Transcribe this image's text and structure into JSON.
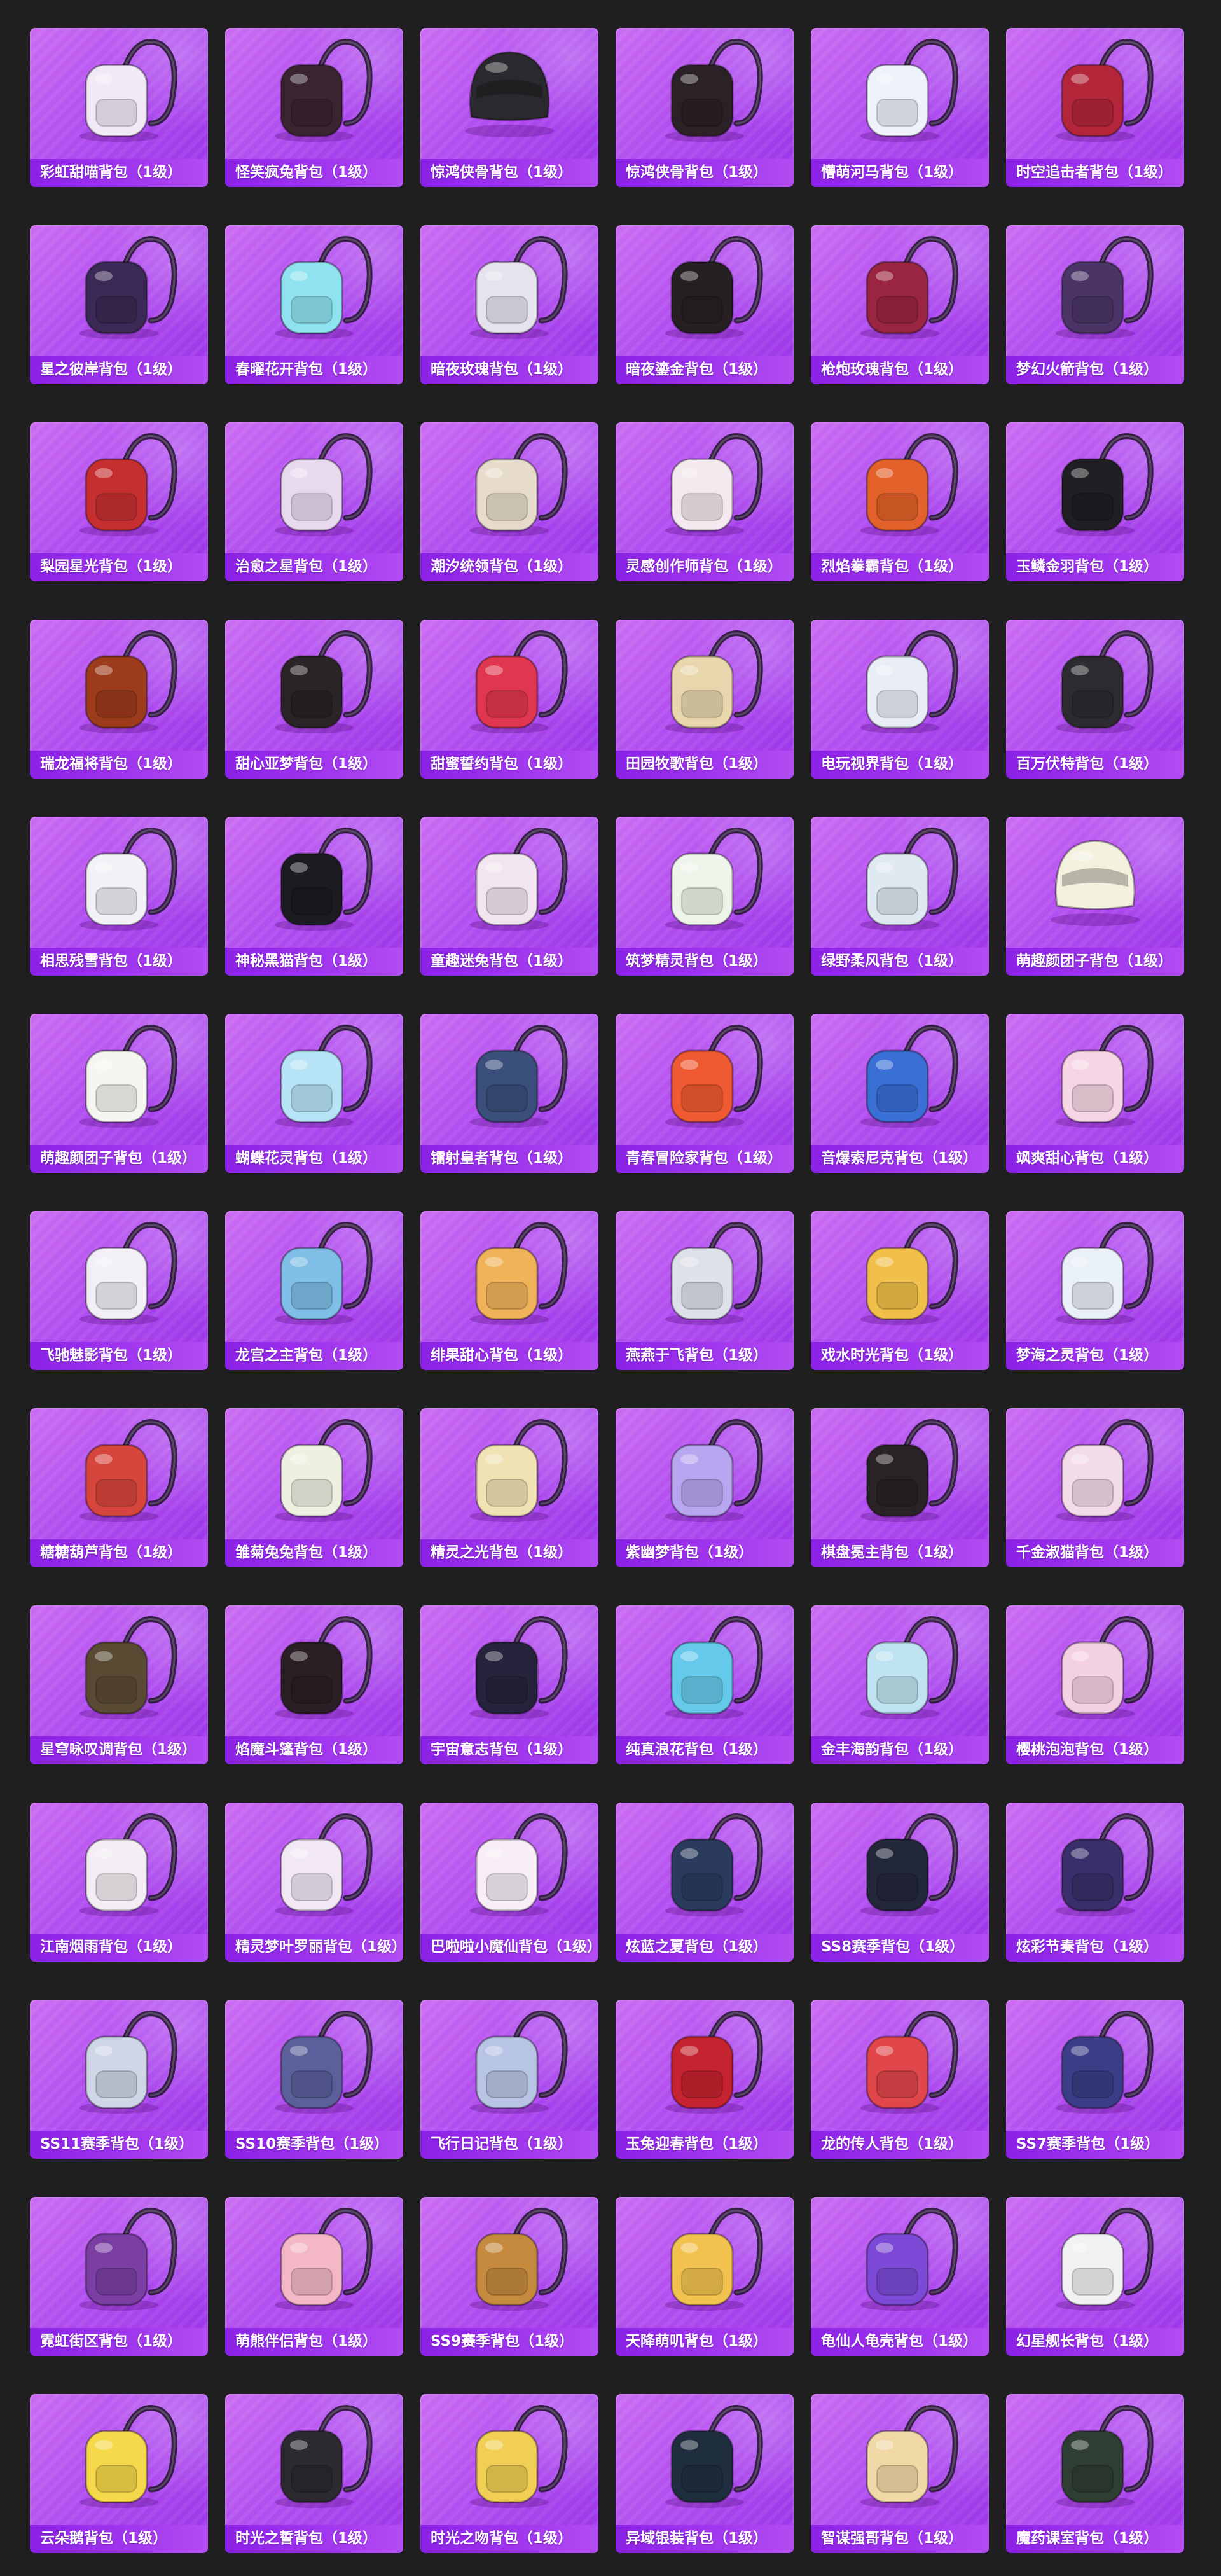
{
  "gallery": {
    "items": [
      {
        "label": "彩虹甜喵背包（1级）",
        "icon": "backpack-icon",
        "color": "#f2e9f6"
      },
      {
        "label": "怪笑疯兔背包（1级）",
        "icon": "backpack-icon",
        "color": "#3a2430"
      },
      {
        "label": "惊鸿侠骨背包（1级）",
        "icon": "helmet-icon",
        "color": "#2a2a2e"
      },
      {
        "label": "惊鸿侠骨背包（1级）",
        "icon": "backpack-icon",
        "color": "#2b2227"
      },
      {
        "label": "懵萌河马背包（1级）",
        "icon": "backpack-icon",
        "color": "#eef2fb"
      },
      {
        "label": "时空追击者背包（1级）",
        "icon": "backpack-icon",
        "color": "#b3263a"
      },
      {
        "label": "星之彼岸背包（1级）",
        "icon": "backpack-icon",
        "color": "#3b2a55"
      },
      {
        "label": "春曜花开背包（1级）",
        "icon": "backpack-icon",
        "color": "#8fe3f0"
      },
      {
        "label": "暗夜玫瑰背包（1级）",
        "icon": "backpack-icon",
        "color": "#e7e3ee"
      },
      {
        "label": "暗夜鎏金背包（1级）",
        "icon": "backpack-icon",
        "color": "#262022"
      },
      {
        "label": "枪炮玫瑰背包（1级）",
        "icon": "backpack-icon",
        "color": "#9a2540"
      },
      {
        "label": "梦幻火箭背包（1级）",
        "icon": "backpack-icon",
        "color": "#4a3566"
      },
      {
        "label": "梨园星光背包（1级）",
        "icon": "backpack-icon",
        "color": "#c62f2f"
      },
      {
        "label": "治愈之星背包（1级）",
        "icon": "backpack-icon",
        "color": "#e9d9ef"
      },
      {
        "label": "潮汐统领背包（1级）",
        "icon": "backpack-icon",
        "color": "#e7dccb"
      },
      {
        "label": "灵感创作师背包（1级）",
        "icon": "backpack-icon",
        "color": "#f3e9ef"
      },
      {
        "label": "烈焰拳霸背包（1级）",
        "icon": "backpack-icon",
        "color": "#e3612a"
      },
      {
        "label": "玉鳞金羽背包（1级）",
        "icon": "backpack-icon",
        "color": "#1f1f24"
      },
      {
        "label": "瑞龙福将背包（1级）",
        "icon": "backpack-icon",
        "color": "#9d3b1d"
      },
      {
        "label": "甜心亚梦背包（1级）",
        "icon": "backpack-icon",
        "color": "#2a2328"
      },
      {
        "label": "甜蜜誓约背包（1级）",
        "icon": "backpack-icon",
        "color": "#e0364f"
      },
      {
        "label": "田园牧歌背包（1级）",
        "icon": "backpack-icon",
        "color": "#e8d6ac"
      },
      {
        "label": "电玩视界背包（1级）",
        "icon": "backpack-icon",
        "color": "#e9eef6"
      },
      {
        "label": "百万伏特背包（1级）",
        "icon": "backpack-icon",
        "color": "#2d2b2f"
      },
      {
        "label": "相思残雪背包（1级）",
        "icon": "backpack-icon",
        "color": "#f2f2f6"
      },
      {
        "label": "神秘黑猫背包（1级）",
        "icon": "backpack-icon",
        "color": "#1d1b22"
      },
      {
        "label": "童趣迷兔背包（1级）",
        "icon": "backpack-icon",
        "color": "#f1e6ef"
      },
      {
        "label": "筑梦精灵背包（1级）",
        "icon": "backpack-icon",
        "color": "#eef4e9"
      },
      {
        "label": "绿野柔风背包（1级）",
        "icon": "backpack-icon",
        "color": "#dfe9f2"
      },
      {
        "label": "萌趣颜团子背包（1级）",
        "icon": "helmet-icon",
        "color": "#f3f2df"
      },
      {
        "label": "萌趣颜团子背包（1级）",
        "icon": "backpack-icon",
        "color": "#f6f6f0"
      },
      {
        "label": "蝴蝶花灵背包（1级）",
        "icon": "backpack-icon",
        "color": "#b6e3f6"
      },
      {
        "label": "镭射皇者背包（1级）",
        "icon": "backpack-icon",
        "color": "#3b4f7c"
      },
      {
        "label": "青春冒险家背包（1级）",
        "icon": "backpack-icon",
        "color": "#ef5a32"
      },
      {
        "label": "音爆索尼克背包（1级）",
        "icon": "backpack-icon",
        "color": "#3a6fd6"
      },
      {
        "label": "飒爽甜心背包（1级）",
        "icon": "backpack-icon",
        "color": "#f6d6e4"
      },
      {
        "label": "飞驰魅影背包（1级）",
        "icon": "backpack-icon",
        "color": "#f2f0f6"
      },
      {
        "label": "龙宫之主背包（1级）",
        "icon": "backpack-icon",
        "color": "#7fbfe7"
      },
      {
        "label": "绯果甜心背包（1级）",
        "icon": "backpack-icon",
        "color": "#f0b35a"
      },
      {
        "label": "燕燕于飞背包（1级）",
        "icon": "backpack-icon",
        "color": "#dfe1ea"
      },
      {
        "label": "戏水时光背包（1级）",
        "icon": "backpack-icon",
        "color": "#f0c04a"
      },
      {
        "label": "梦海之灵背包（1级）",
        "icon": "backpack-icon",
        "color": "#eaf0f8"
      },
      {
        "label": "糖糖葫芦背包（1级）",
        "icon": "backpack-icon",
        "color": "#d7463c"
      },
      {
        "label": "雏菊兔兔背包（1级）",
        "icon": "backpack-icon",
        "color": "#eef0e2"
      },
      {
        "label": "精灵之光背包（1级）",
        "icon": "backpack-icon",
        "color": "#f0e2b3"
      },
      {
        "label": "紫幽梦背包（1级）",
        "icon": "backpack-icon",
        "color": "#b7a6f0"
      },
      {
        "label": "棋盘冕主背包（1级）",
        "icon": "backpack-icon",
        "color": "#2a2326"
      },
      {
        "label": "千金淑猫背包（1级）",
        "icon": "backpack-icon",
        "color": "#f3dbe8"
      },
      {
        "label": "星穹咏叹调背包（1级）",
        "icon": "backpack-icon",
        "color": "#5a4a34"
      },
      {
        "label": "焰魔斗篷背包（1级）",
        "icon": "backpack-icon",
        "color": "#2a1f24"
      },
      {
        "label": "宇宙意志背包（1级）",
        "icon": "backpack-icon",
        "color": "#25243c"
      },
      {
        "label": "纯真浪花背包（1级）",
        "icon": "backpack-icon",
        "color": "#65c9ea"
      },
      {
        "label": "金丰海韵背包（1级）",
        "icon": "backpack-icon",
        "color": "#bfe3f0"
      },
      {
        "label": "樱桃泡泡背包（1级）",
        "icon": "backpack-icon",
        "color": "#f4d1e2"
      },
      {
        "label": "江南烟雨背包（1级）",
        "icon": "backpack-icon",
        "color": "#f3eef3"
      },
      {
        "label": "精灵梦叶罗丽背包（1级）",
        "icon": "backpack-icon",
        "color": "#f1e8f4"
      },
      {
        "label": "巴啦啦小魔仙背包（1级）",
        "icon": "backpack-icon",
        "color": "#f7eef6"
      },
      {
        "label": "炫蓝之夏背包（1级）",
        "icon": "backpack-icon",
        "color": "#2b3b5e"
      },
      {
        "label": "SS8赛季背包（1级）",
        "icon": "backpack-icon",
        "color": "#23273a"
      },
      {
        "label": "炫彩节奏背包（1级）",
        "icon": "backpack-icon",
        "color": "#3a2f6a"
      },
      {
        "label": "SS11赛季背包（1级）",
        "icon": "backpack-icon",
        "color": "#cfd6e6"
      },
      {
        "label": "SS10赛季背包（1级）",
        "icon": "backpack-icon",
        "color": "#5b5f9a"
      },
      {
        "label": "飞行日记背包（1级）",
        "icon": "backpack-icon",
        "color": "#b8c4e3"
      },
      {
        "label": "玉兔迎春背包（1级）",
        "icon": "backpack-icon",
        "color": "#c5232f"
      },
      {
        "label": "龙的传人背包（1级）",
        "icon": "backpack-icon",
        "color": "#e0464a"
      },
      {
        "label": "SS7赛季背包（1级）",
        "icon": "backpack-icon",
        "color": "#3b3e86"
      },
      {
        "label": "霓虹街区背包（1级）",
        "icon": "backpack-icon",
        "color": "#7b3fa3"
      },
      {
        "label": "萌熊伴侣背包（1级）",
        "icon": "backpack-icon",
        "color": "#f3b7c6"
      },
      {
        "label": "SS9赛季背包（1级）",
        "icon": "backpack-icon",
        "color": "#c58a3e"
      },
      {
        "label": "天降萌叽背包（1级）",
        "icon": "backpack-icon",
        "color": "#f2c24f"
      },
      {
        "label": "龟仙人龟壳背包（1级）",
        "icon": "backpack-icon",
        "color": "#7c4ad6"
      },
      {
        "label": "幻星舰长背包（1级）",
        "icon": "backpack-icon",
        "color": "#f1f1f4"
      },
      {
        "label": "云朵鹅背包（1级）",
        "icon": "backpack-icon",
        "color": "#f5d94a"
      },
      {
        "label": "时光之誓背包（1级）",
        "icon": "backpack-icon",
        "color": "#2c2a30"
      },
      {
        "label": "时光之吻背包（1级）",
        "icon": "backpack-icon",
        "color": "#f0cf54"
      },
      {
        "label": "异域银装背包（1级）",
        "icon": "backpack-icon",
        "color": "#1f2e3f"
      },
      {
        "label": "智谋强哥背包（1级）",
        "icon": "backpack-icon",
        "color": "#f0d9a6"
      },
      {
        "label": "魔药课室背包（1级）",
        "icon": "backpack-icon",
        "color": "#2f3e33"
      }
    ]
  }
}
